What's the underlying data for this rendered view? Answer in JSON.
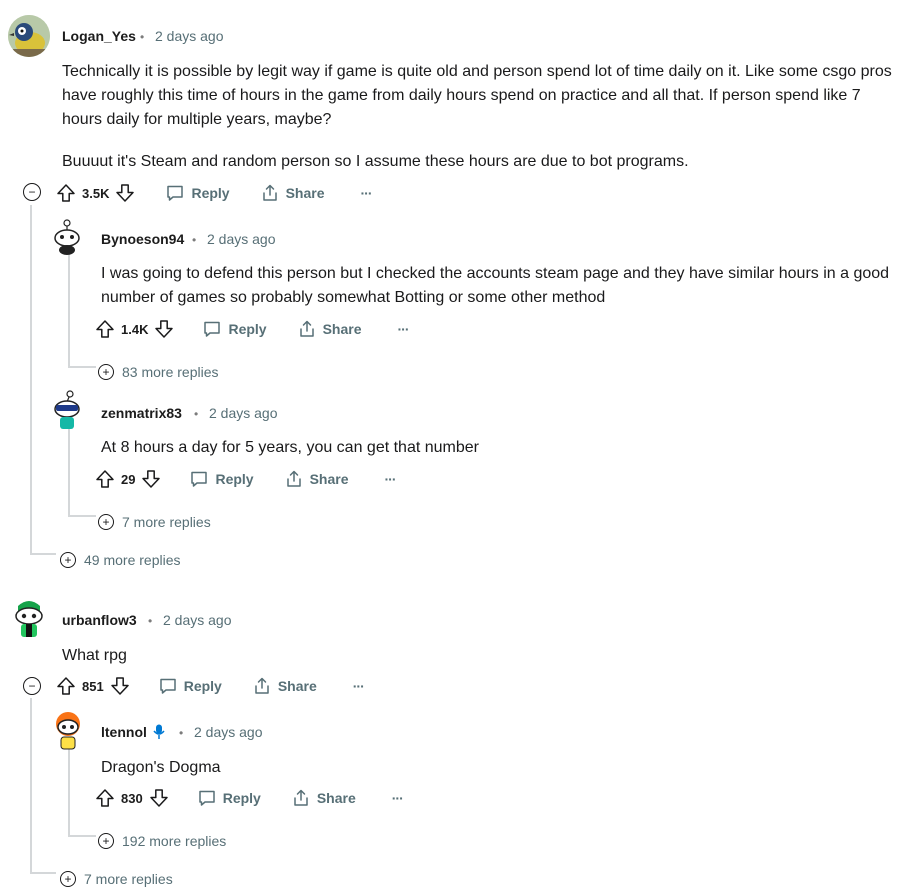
{
  "comments": [
    {
      "user": "Logan_Yes",
      "time": "2 days ago",
      "paragraphs": [
        "Technically it is possible by legit way if game is quite old and person spend lot of time daily on it. Like some csgo pros have roughly this time of hours in the game from daily hours spend on practice and all that. If person spend like 7 hours daily for multiple years, maybe?",
        "Buuuut it's Steam and random person so I assume these hours are due to bot programs."
      ],
      "votes": "3.5K",
      "more_replies": "49 more replies",
      "replies": [
        {
          "user": "Bynoeson94",
          "time": "2 days ago",
          "text": "I was going to defend this person but I checked the accounts steam page and they have similar hours in a good number of games so probably somewhat Botting or some other method",
          "votes": "1.4K",
          "more_replies": "83 more replies"
        },
        {
          "user": "zenmatrix83",
          "time": "2 days ago",
          "text": "At 8 hours a day for 5 years, you can get that number",
          "votes": "29",
          "more_replies": "7 more replies"
        }
      ]
    },
    {
      "user": "urbanflow3",
      "time": "2 days ago",
      "paragraphs": [
        "What rpg"
      ],
      "votes": "851",
      "more_replies": "7 more replies",
      "replies": [
        {
          "user": "ltennol",
          "time": "2 days ago",
          "text": "Dragon's Dogma",
          "votes": "830",
          "more_replies": "192 more replies",
          "badge_icon": "microphone-icon"
        }
      ]
    }
  ],
  "labels": {
    "reply": "Reply",
    "share": "Share",
    "overflow": "···",
    "separator": "•",
    "collapse": "−",
    "expand": "+"
  },
  "colors": {
    "meta": "#576f76",
    "thread_line": "#d4d7d9",
    "badge": "#0079d3"
  }
}
